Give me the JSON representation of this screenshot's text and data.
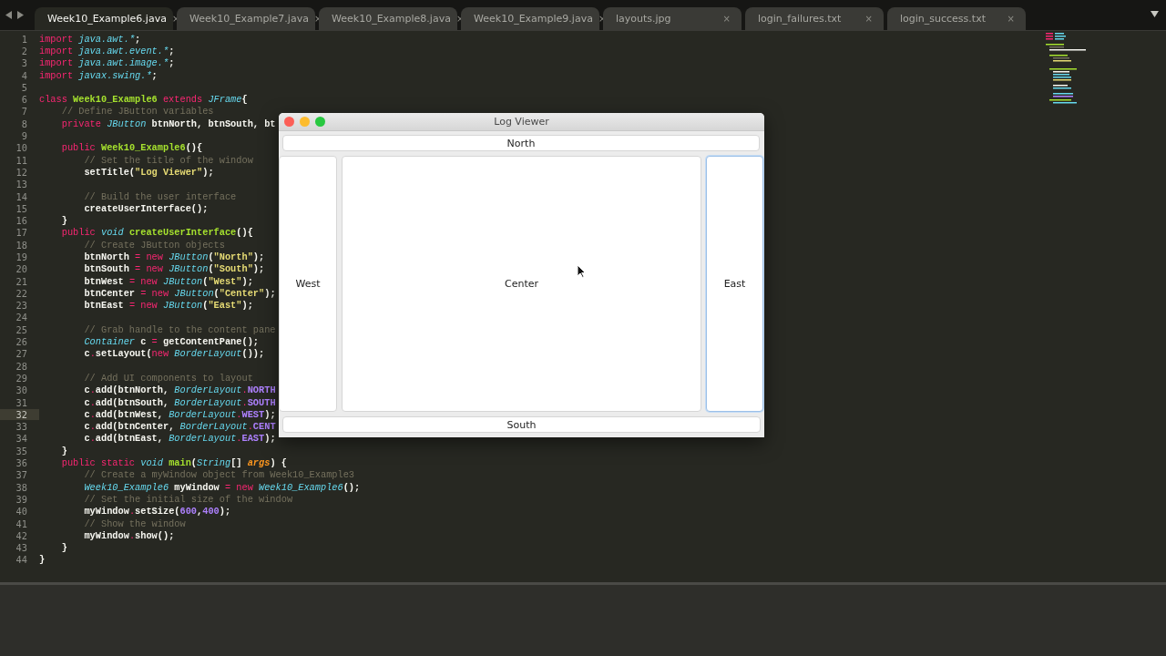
{
  "tabs": [
    {
      "label": "Week10_Example6.java",
      "close": "×",
      "selected": true
    },
    {
      "label": "Week10_Example7.java",
      "close": "×",
      "selected": false
    },
    {
      "label": "Week10_Example8.java",
      "close": "×",
      "selected": false
    },
    {
      "label": "Week10_Example9.java",
      "close": "×",
      "selected": false
    },
    {
      "label": "layouts.jpg",
      "close": "×",
      "selected": false
    },
    {
      "label": "login_failures.txt",
      "close": "×",
      "selected": false
    },
    {
      "label": "login_success.txt",
      "close": "×",
      "selected": false
    }
  ],
  "editor": {
    "lines": [
      {
        "num": "1",
        "current": false,
        "tokens": [
          {
            "kind": "kw",
            "text": "import "
          },
          {
            "kind": "type",
            "text": "java.awt.*"
          },
          {
            "kind": "plain",
            "text": ";"
          }
        ]
      },
      {
        "num": "2",
        "current": false,
        "tokens": [
          {
            "kind": "kw",
            "text": "import "
          },
          {
            "kind": "type",
            "text": "java.awt.event.*"
          },
          {
            "kind": "plain",
            "text": ";"
          }
        ]
      },
      {
        "num": "3",
        "current": false,
        "tokens": [
          {
            "kind": "kw",
            "text": "import "
          },
          {
            "kind": "type",
            "text": "java.awt.image.*"
          },
          {
            "kind": "plain",
            "text": ";"
          }
        ]
      },
      {
        "num": "4",
        "current": false,
        "tokens": [
          {
            "kind": "kw",
            "text": "import "
          },
          {
            "kind": "type",
            "text": "javax.swing.*"
          },
          {
            "kind": "plain",
            "text": ";"
          }
        ]
      },
      {
        "num": "5",
        "current": false
      },
      {
        "num": "6",
        "current": false,
        "tokens": [
          {
            "kind": "kw",
            "text": "class "
          },
          {
            "kind": "cls",
            "text": "Week10_Example6"
          },
          {
            "kind": "kw",
            "text": " extends "
          },
          {
            "kind": "type",
            "text": "JFrame"
          },
          {
            "kind": "plain",
            "text": "{"
          }
        ]
      },
      {
        "num": "7",
        "current": false,
        "tokens": [
          {
            "kind": "com",
            "text": "    // Define JButton variables"
          }
        ]
      },
      {
        "num": "8",
        "current": false,
        "tokens": [
          {
            "kind": "kw",
            "text": "    private "
          },
          {
            "kind": "type",
            "text": "JButton"
          },
          {
            "kind": "plain",
            "text": " btnNorth, btnSouth, bt"
          }
        ]
      },
      {
        "num": "9",
        "current": false
      },
      {
        "num": "10",
        "current": false,
        "tokens": [
          {
            "kind": "kw",
            "text": "    public "
          },
          {
            "kind": "cls",
            "text": "Week10_Example6"
          },
          {
            "kind": "plain",
            "text": "(){"
          }
        ]
      },
      {
        "num": "11",
        "current": false,
        "tokens": [
          {
            "kind": "com",
            "text": "        // Set the title of the window"
          }
        ]
      },
      {
        "num": "12",
        "current": false,
        "tokens": [
          {
            "kind": "plain",
            "text": "        setTitle("
          },
          {
            "kind": "str",
            "text": "\"Log Viewer\""
          },
          {
            "kind": "plain",
            "text": ");"
          }
        ]
      },
      {
        "num": "13",
        "current": false
      },
      {
        "num": "14",
        "current": false,
        "tokens": [
          {
            "kind": "com",
            "text": "        // Build the user interface"
          }
        ]
      },
      {
        "num": "15",
        "current": false,
        "tokens": [
          {
            "kind": "plain",
            "text": "        createUserInterface();"
          }
        ]
      },
      {
        "num": "16",
        "current": false,
        "tokens": [
          {
            "kind": "plain",
            "text": "    }"
          }
        ]
      },
      {
        "num": "17",
        "current": false,
        "tokens": [
          {
            "kind": "kw",
            "text": "    public "
          },
          {
            "kind": "type",
            "text": "void "
          },
          {
            "kind": "cls",
            "text": "createUserInterface"
          },
          {
            "kind": "plain",
            "text": "(){"
          }
        ]
      },
      {
        "num": "18",
        "current": false,
        "tokens": [
          {
            "kind": "com",
            "text": "        // Create JButton objects"
          }
        ]
      },
      {
        "num": "19",
        "current": false,
        "tokens": [
          {
            "kind": "plain",
            "text": "        btnNorth "
          },
          {
            "kind": "kw",
            "text": "= new "
          },
          {
            "kind": "type",
            "text": "JButton"
          },
          {
            "kind": "plain",
            "text": "("
          },
          {
            "kind": "str",
            "text": "\"North\""
          },
          {
            "kind": "plain",
            "text": ");"
          }
        ]
      },
      {
        "num": "20",
        "current": false,
        "tokens": [
          {
            "kind": "plain",
            "text": "        btnSouth "
          },
          {
            "kind": "kw",
            "text": "= new "
          },
          {
            "kind": "type",
            "text": "JButton"
          },
          {
            "kind": "plain",
            "text": "("
          },
          {
            "kind": "str",
            "text": "\"South\""
          },
          {
            "kind": "plain",
            "text": ");"
          }
        ]
      },
      {
        "num": "21",
        "current": false,
        "tokens": [
          {
            "kind": "plain",
            "text": "        btnWest "
          },
          {
            "kind": "kw",
            "text": "= new "
          },
          {
            "kind": "type",
            "text": "JButton"
          },
          {
            "kind": "plain",
            "text": "("
          },
          {
            "kind": "str",
            "text": "\"West\""
          },
          {
            "kind": "plain",
            "text": ");"
          }
        ]
      },
      {
        "num": "22",
        "current": false,
        "tokens": [
          {
            "kind": "plain",
            "text": "        btnCenter "
          },
          {
            "kind": "kw",
            "text": "= new "
          },
          {
            "kind": "type",
            "text": "JButton"
          },
          {
            "kind": "plain",
            "text": "("
          },
          {
            "kind": "str",
            "text": "\"Center\""
          },
          {
            "kind": "plain",
            "text": ");"
          }
        ]
      },
      {
        "num": "23",
        "current": false,
        "tokens": [
          {
            "kind": "plain",
            "text": "        btnEast "
          },
          {
            "kind": "kw",
            "text": "= new "
          },
          {
            "kind": "type",
            "text": "JButton"
          },
          {
            "kind": "plain",
            "text": "("
          },
          {
            "kind": "str",
            "text": "\"East\""
          },
          {
            "kind": "plain",
            "text": ");"
          }
        ]
      },
      {
        "num": "24",
        "current": false
      },
      {
        "num": "25",
        "current": false,
        "tokens": [
          {
            "kind": "com",
            "text": "        // Grab handle to the content pane"
          }
        ]
      },
      {
        "num": "26",
        "current": false,
        "tokens": [
          {
            "kind": "type",
            "text": "        Container"
          },
          {
            "kind": "plain",
            "text": " c "
          },
          {
            "kind": "kw",
            "text": "="
          },
          {
            "kind": "plain",
            "text": " getContentPane();"
          }
        ]
      },
      {
        "num": "27",
        "current": false,
        "tokens": [
          {
            "kind": "plain",
            "text": "        c"
          },
          {
            "kind": "kw",
            "text": "."
          },
          {
            "kind": "plain",
            "text": "setLayout("
          },
          {
            "kind": "kw",
            "text": "new "
          },
          {
            "kind": "type",
            "text": "BorderLayout"
          },
          {
            "kind": "plain",
            "text": "());"
          }
        ]
      },
      {
        "num": "28",
        "current": false
      },
      {
        "num": "29",
        "current": false,
        "tokens": [
          {
            "kind": "com",
            "text": "        // Add UI components to layout"
          }
        ]
      },
      {
        "num": "30",
        "current": false,
        "tokens": [
          {
            "kind": "plain",
            "text": "        c"
          },
          {
            "kind": "kw",
            "text": "."
          },
          {
            "kind": "plain",
            "text": "add(btnNorth, "
          },
          {
            "kind": "type",
            "text": "BorderLayout"
          },
          {
            "kind": "kw",
            "text": "."
          },
          {
            "kind": "num",
            "text": "NORTH"
          }
        ]
      },
      {
        "num": "31",
        "current": false,
        "tokens": [
          {
            "kind": "plain",
            "text": "        c"
          },
          {
            "kind": "kw",
            "text": "."
          },
          {
            "kind": "plain",
            "text": "add(btnSouth, "
          },
          {
            "kind": "type",
            "text": "BorderLayout"
          },
          {
            "kind": "kw",
            "text": "."
          },
          {
            "kind": "num",
            "text": "SOUTH"
          }
        ]
      },
      {
        "num": "32",
        "current": true,
        "tokens": [
          {
            "kind": "plain",
            "text": "        c"
          },
          {
            "kind": "kw",
            "text": "."
          },
          {
            "kind": "plain",
            "text": "add(btnWest, "
          },
          {
            "kind": "type",
            "text": "BorderLayout"
          },
          {
            "kind": "kw",
            "text": "."
          },
          {
            "kind": "num",
            "text": "WEST"
          },
          {
            "kind": "plain",
            "text": ");"
          }
        ]
      },
      {
        "num": "33",
        "current": false,
        "tokens": [
          {
            "kind": "plain",
            "text": "        c"
          },
          {
            "kind": "kw",
            "text": "."
          },
          {
            "kind": "plain",
            "text": "add(btnCenter, "
          },
          {
            "kind": "type",
            "text": "BorderLayout"
          },
          {
            "kind": "kw",
            "text": "."
          },
          {
            "kind": "num",
            "text": "CENT"
          }
        ]
      },
      {
        "num": "34",
        "current": false,
        "tokens": [
          {
            "kind": "plain",
            "text": "        c"
          },
          {
            "kind": "kw",
            "text": "."
          },
          {
            "kind": "plain",
            "text": "add(btnEast, "
          },
          {
            "kind": "type",
            "text": "BorderLayout"
          },
          {
            "kind": "kw",
            "text": "."
          },
          {
            "kind": "num",
            "text": "EAST"
          },
          {
            "kind": "plain",
            "text": ");"
          }
        ]
      },
      {
        "num": "35",
        "current": false,
        "tokens": [
          {
            "kind": "plain",
            "text": "    }"
          }
        ]
      },
      {
        "num": "36",
        "current": false,
        "tokens": [
          {
            "kind": "kw",
            "text": "    public static "
          },
          {
            "kind": "type",
            "text": "void "
          },
          {
            "kind": "cls",
            "text": "main"
          },
          {
            "kind": "plain",
            "text": "("
          },
          {
            "kind": "type",
            "text": "String"
          },
          {
            "kind": "plain",
            "text": "[] "
          },
          {
            "kind": "arg",
            "text": "args"
          },
          {
            "kind": "plain",
            "text": ") {"
          }
        ]
      },
      {
        "num": "37",
        "current": false,
        "tokens": [
          {
            "kind": "com",
            "text": "        // Create a myWindow object from Week10_Example3"
          }
        ]
      },
      {
        "num": "38",
        "current": false,
        "tokens": [
          {
            "kind": "type",
            "text": "        Week10_Example6"
          },
          {
            "kind": "plain",
            "text": " myWindow "
          },
          {
            "kind": "kw",
            "text": "= new "
          },
          {
            "kind": "type",
            "text": "Week10_Example6"
          },
          {
            "kind": "plain",
            "text": "();"
          }
        ]
      },
      {
        "num": "39",
        "current": false,
        "tokens": [
          {
            "kind": "com",
            "text": "        // Set the initial size of the window"
          }
        ]
      },
      {
        "num": "40",
        "current": false,
        "tokens": [
          {
            "kind": "plain",
            "text": "        myWindow"
          },
          {
            "kind": "kw",
            "text": "."
          },
          {
            "kind": "plain",
            "text": "setSize("
          },
          {
            "kind": "num",
            "text": "600"
          },
          {
            "kind": "plain",
            "text": ","
          },
          {
            "kind": "num",
            "text": "400"
          },
          {
            "kind": "plain",
            "text": ");"
          }
        ]
      },
      {
        "num": "41",
        "current": false,
        "tokens": [
          {
            "kind": "com",
            "text": "        // Show the window"
          }
        ]
      },
      {
        "num": "42",
        "current": false,
        "tokens": [
          {
            "kind": "plain",
            "text": "        myWindow"
          },
          {
            "kind": "kw",
            "text": "."
          },
          {
            "kind": "plain",
            "text": "show();"
          }
        ]
      },
      {
        "num": "43",
        "current": false,
        "tokens": [
          {
            "kind": "plain",
            "text": "    }"
          }
        ]
      },
      {
        "num": "44",
        "current": false,
        "tokens": [
          {
            "kind": "plain",
            "text": "}"
          }
        ]
      }
    ]
  },
  "app_window": {
    "title": "Log Viewer",
    "buttons": [
      {
        "kind": "north",
        "label": "North",
        "focused": false
      },
      {
        "kind": "west",
        "label": "West",
        "focused": false
      },
      {
        "kind": "center",
        "label": "Center",
        "focused": false
      },
      {
        "kind": "east",
        "label": "East",
        "focused": true
      },
      {
        "kind": "south",
        "label": "South",
        "focused": false
      }
    ]
  }
}
